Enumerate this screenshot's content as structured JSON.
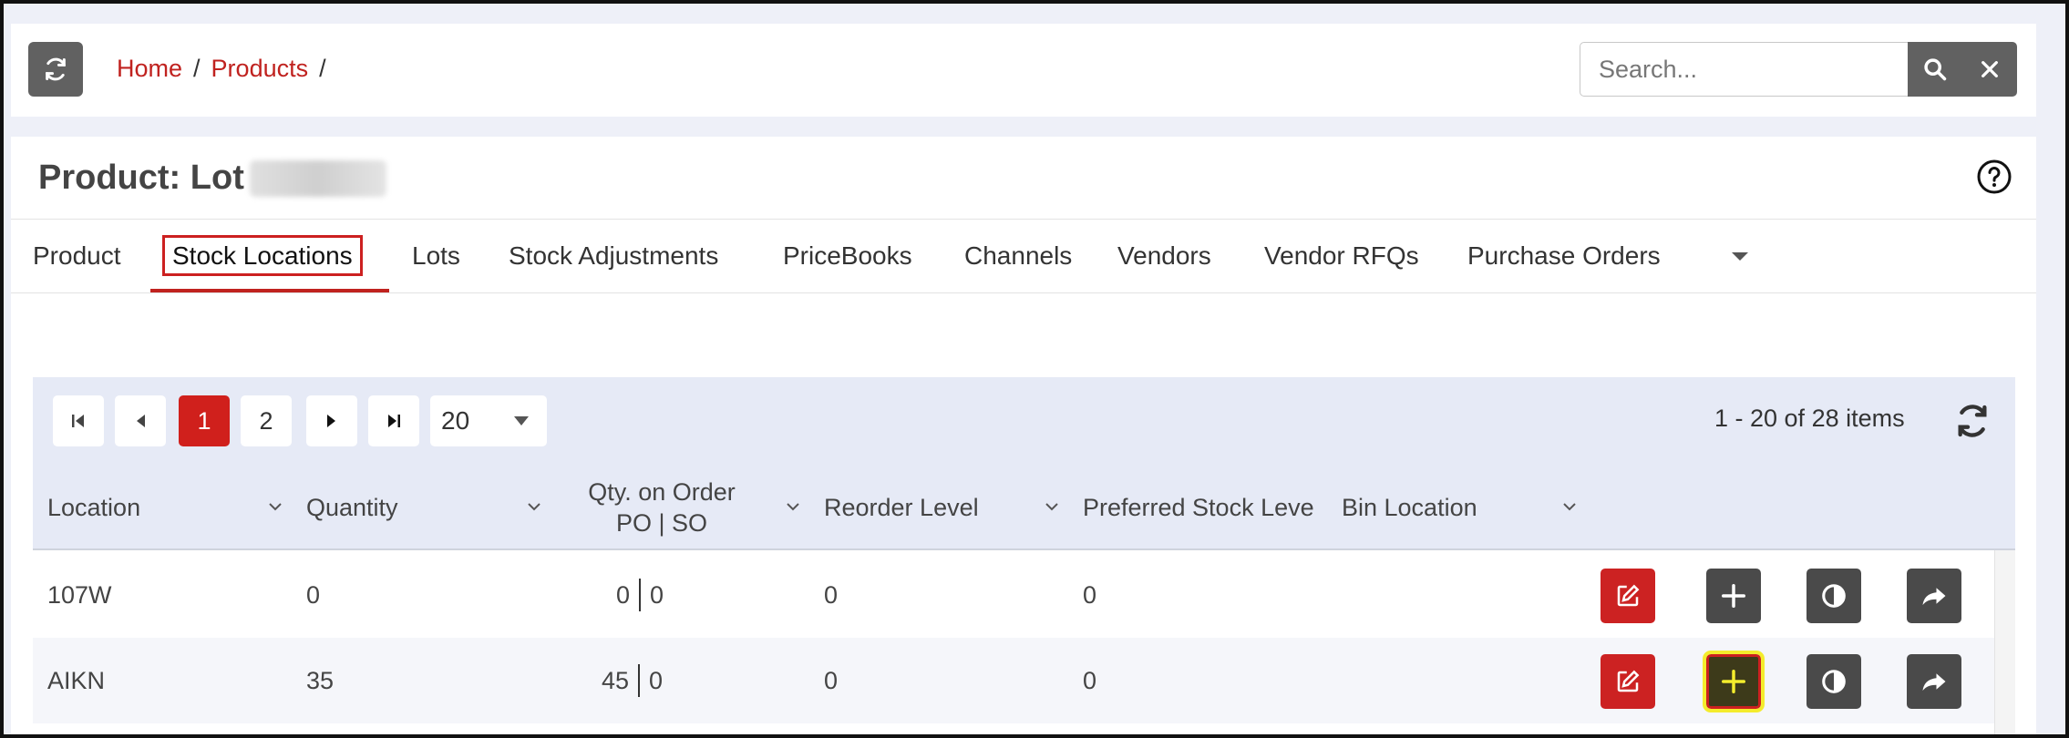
{
  "breadcrumb": {
    "home": "Home",
    "products": "Products",
    "sep": "/"
  },
  "search": {
    "placeholder": "Search...",
    "value": ""
  },
  "page": {
    "title": "Product: Lot"
  },
  "tabs": [
    "Product",
    "Stock Locations",
    "Lots",
    "Stock Adjustments",
    "PriceBooks",
    "Channels",
    "Vendors",
    "Vendor RFQs",
    "Purchase Orders"
  ],
  "active_tab": "Stock Locations",
  "pager": {
    "pages": [
      "1",
      "2"
    ],
    "current": "1",
    "page_size": "20",
    "info": "1 - 20 of 28 items"
  },
  "columns": {
    "location": "Location",
    "quantity": "Quantity",
    "qty_on_order_1": "Qty. on Order",
    "qty_on_order_2": "PO | SO",
    "reorder": "Reorder Level",
    "preferred": "Preferred Stock Leve",
    "bin": "Bin Location"
  },
  "rows": [
    {
      "location": "107W",
      "quantity": "0",
      "po": "0",
      "so": "0",
      "reorder": "0",
      "preferred": "0",
      "bin": ""
    },
    {
      "location": "AIKN",
      "quantity": "35",
      "po": "45",
      "so": "0",
      "reorder": "0",
      "preferred": "0",
      "bin": ""
    }
  ],
  "colors": {
    "accent": "#c0221f",
    "button_dark": "#4a4a4a",
    "highlight": "#f4ec2c"
  }
}
